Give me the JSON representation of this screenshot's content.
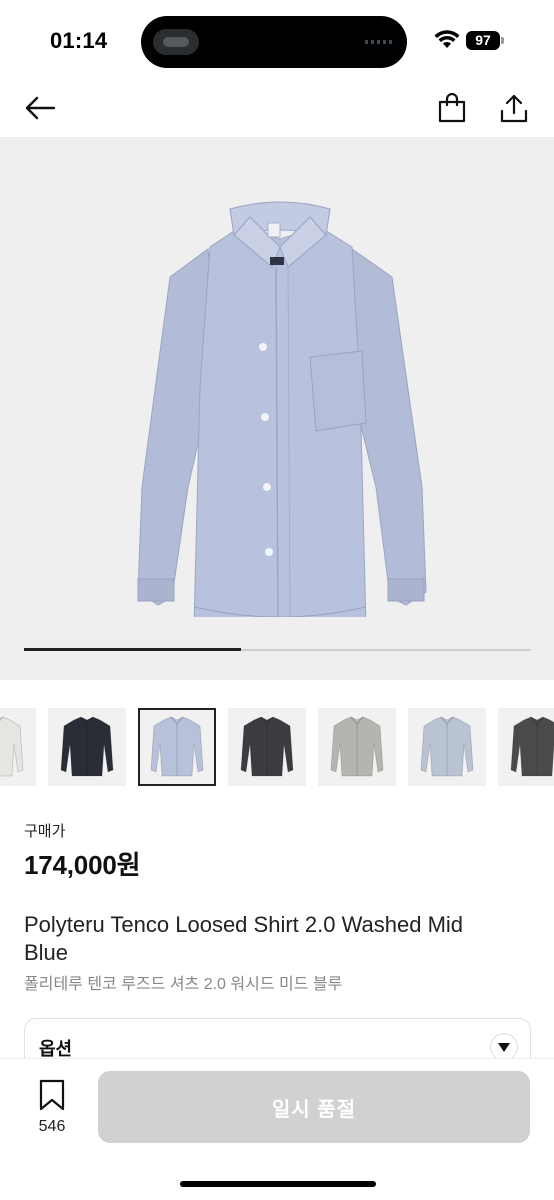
{
  "status_bar": {
    "time": "01:14",
    "battery": "97"
  },
  "nav": {
    "back_icon": "arrow-left-icon",
    "bag_icon": "shopping-bag-icon",
    "share_icon": "share-icon"
  },
  "gallery": {
    "image_index": 3,
    "image_count": 7
  },
  "thumbnails": [
    {
      "color": "#e5e6e2"
    },
    {
      "color": "#2a2d35"
    },
    {
      "color": "#b7c1da"
    },
    {
      "color": "#3b3c41"
    },
    {
      "color": "#b4b5ae"
    },
    {
      "color": "#b9c3d3"
    },
    {
      "color": "#4a4a4c"
    }
  ],
  "product": {
    "price_label": "구매가",
    "price": "174,000원",
    "title_en": "Polyteru Tenco Loosed Shirt 2.0 Washed Mid Blue",
    "title_ko": "폴리테루 텐코 루즈드 셔츠 2.0 워시드 미드 블루"
  },
  "option": {
    "label": "옵션"
  },
  "bottom_bar": {
    "bookmark_count": "546",
    "cta_label": "일시 품절"
  },
  "colors": {
    "shirt": "#b7c0d9",
    "hero_bg": "#efefef",
    "cta_disabled": "#d1d1d1"
  }
}
